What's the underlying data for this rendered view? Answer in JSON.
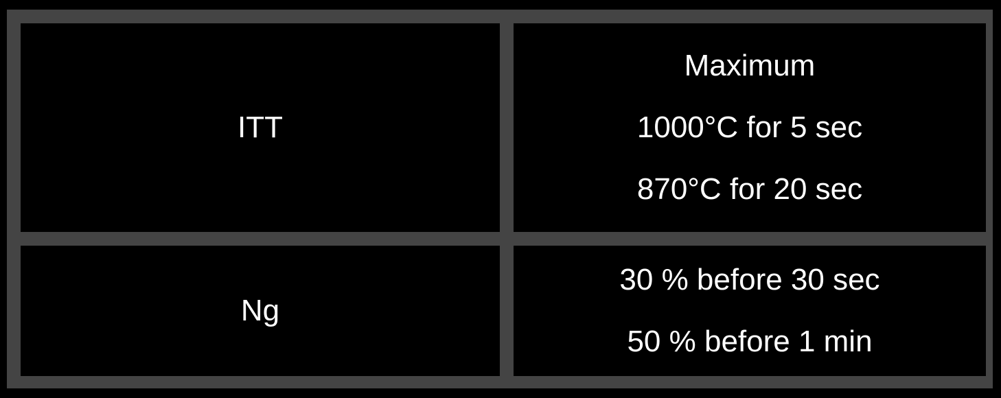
{
  "table": {
    "rows": [
      {
        "parameter": "ITT",
        "limits": [
          "Maximum",
          "1000°C for 5 sec",
          "870°C for 20 sec"
        ]
      },
      {
        "parameter": "Ng",
        "limits": [
          "30 % before 30 sec",
          "50 % before 1 min"
        ]
      }
    ]
  },
  "colors": {
    "background": "#000000",
    "grid": "#444444",
    "text": "#ffffff"
  }
}
